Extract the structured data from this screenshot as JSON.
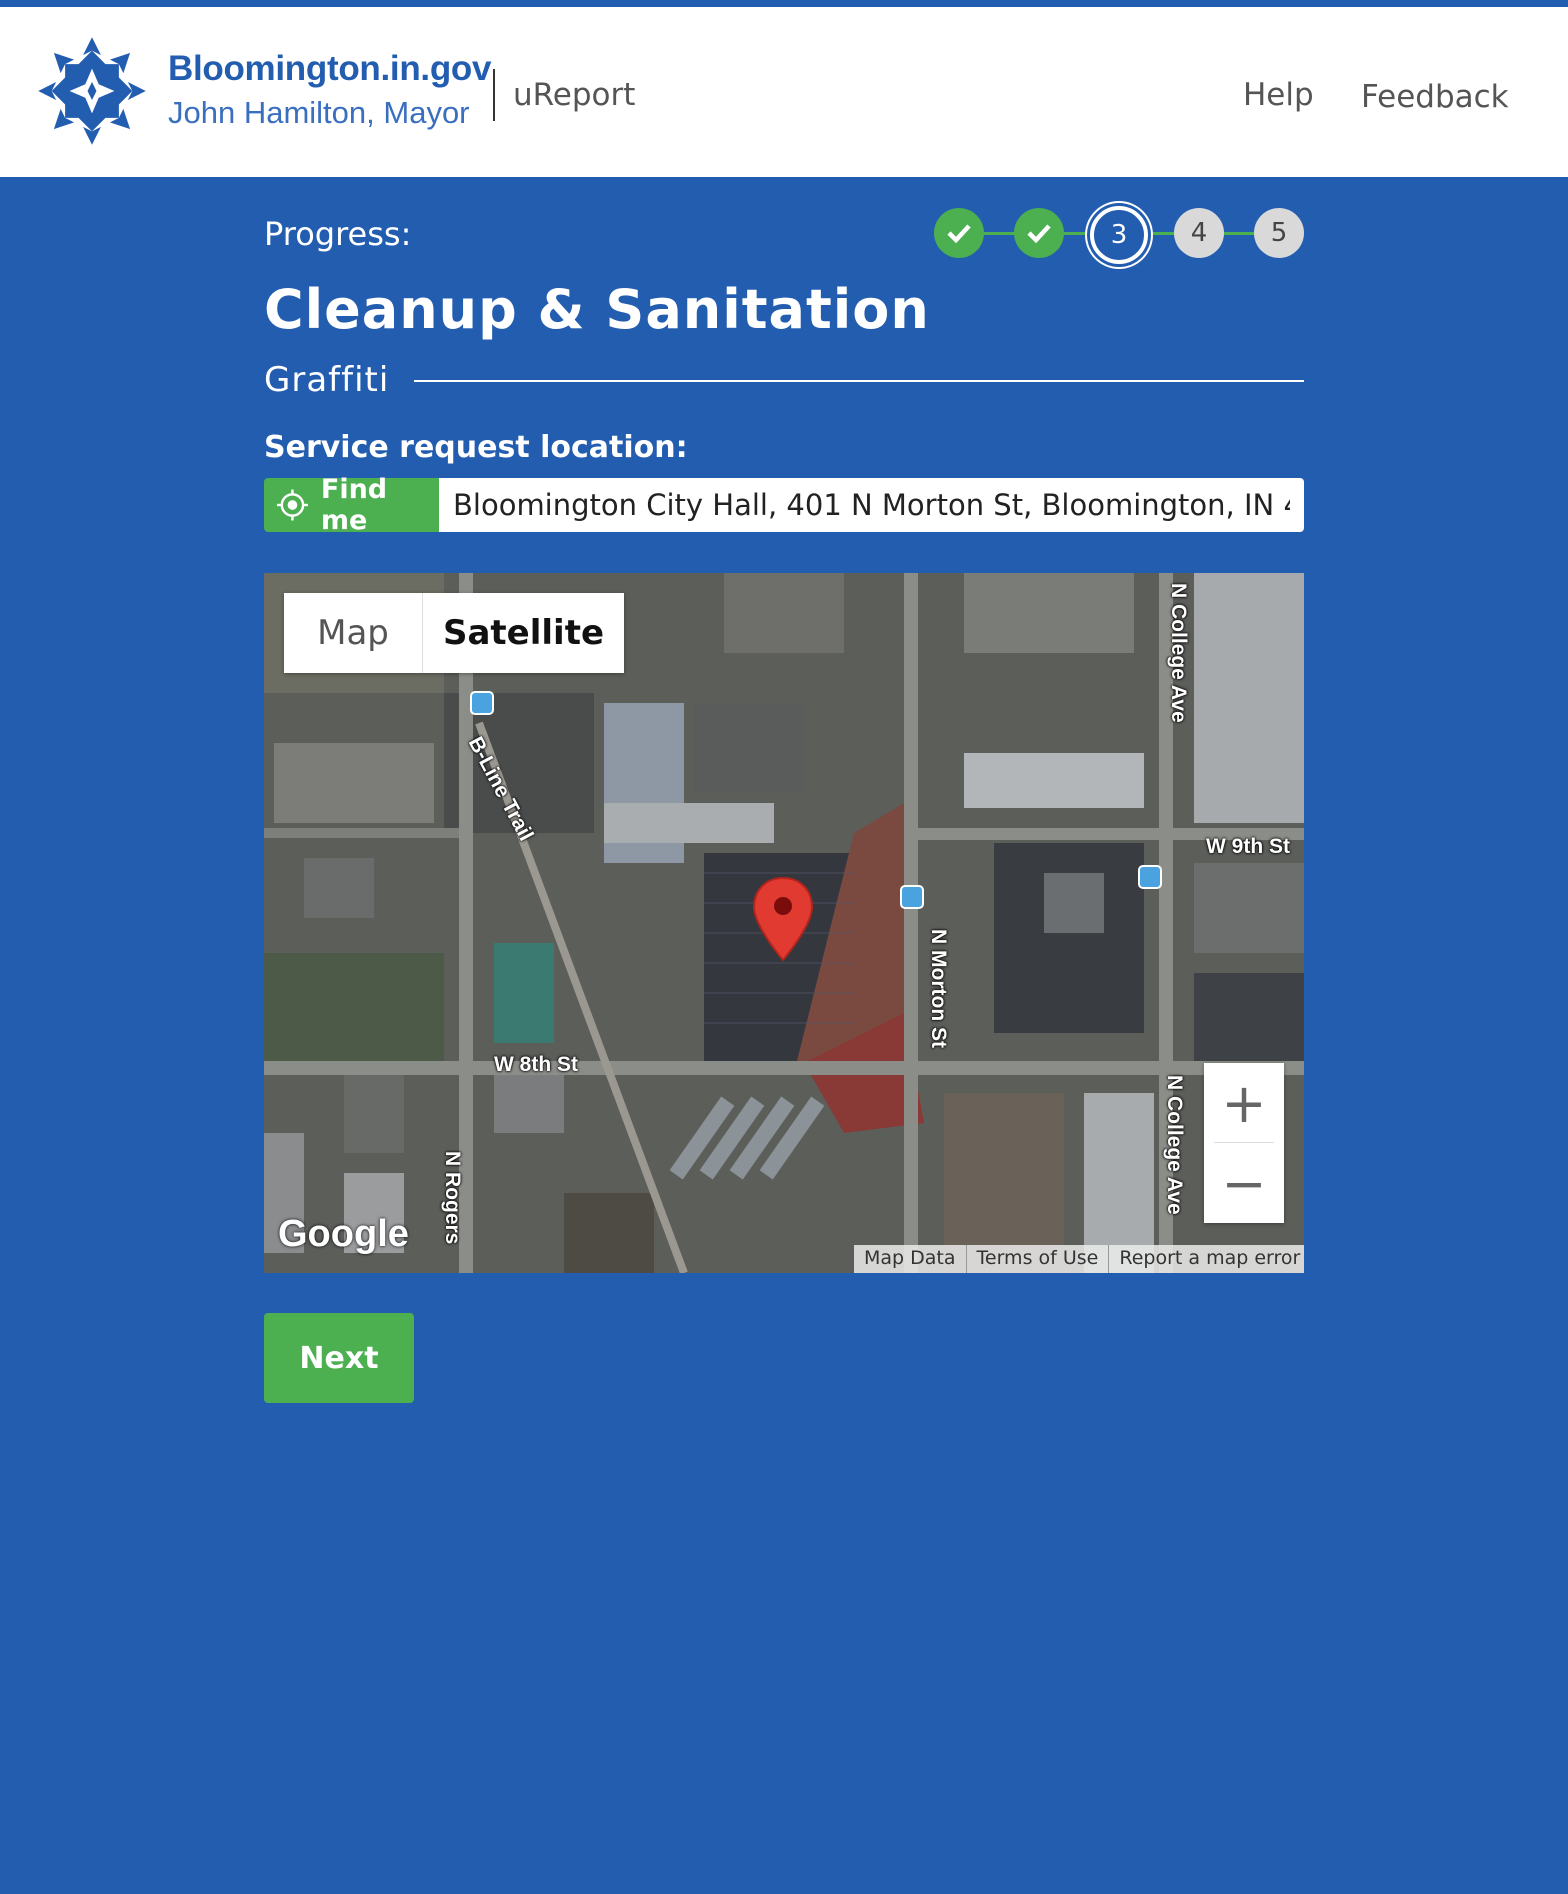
{
  "header": {
    "site_name": "Bloomington.in.gov",
    "mayor": "John Hamilton, Mayor",
    "app_name": "uReport",
    "nav": {
      "help": "Help",
      "feedback": "Feedback"
    }
  },
  "progress": {
    "label": "Progress:",
    "current_step": 3,
    "total_steps": 5,
    "steps": [
      {
        "state": "done",
        "label": ""
      },
      {
        "state": "done",
        "label": ""
      },
      {
        "state": "current",
        "label": "3"
      },
      {
        "state": "todo",
        "label": "4"
      },
      {
        "state": "todo",
        "label": "5"
      }
    ]
  },
  "category": {
    "title": "Cleanup & Sanitation",
    "subcategory": "Graffiti"
  },
  "location": {
    "label": "Service request location:",
    "find_me": "Find me",
    "address_value": "Bloomington City Hall, 401 N Morton St, Bloomington, IN 4"
  },
  "map": {
    "type_map": "Map",
    "type_satellite": "Satellite",
    "selected_type": "Satellite",
    "zoom_in": "+",
    "zoom_out": "−",
    "google": "Google",
    "attribution": {
      "map_data": "Map Data",
      "terms": "Terms of Use",
      "report": "Report a map error"
    },
    "streets": {
      "college_north": "N College Ave",
      "ninth": "W 9th St",
      "bline": "B-Line Trail",
      "morton": "N Morton St",
      "eighth": "W 8th St",
      "college_south": "N College Ave",
      "rogers": "N Rogers"
    }
  },
  "actions": {
    "next": "Next"
  },
  "colors": {
    "brand_blue": "#235db0",
    "success_green": "#4caf50",
    "pin_red": "#e03a31"
  }
}
